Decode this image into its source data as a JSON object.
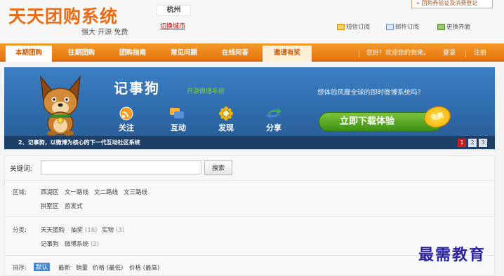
{
  "header": {
    "logo": "天天团购系统",
    "slogan": "强大 开源 免费",
    "city": "杭州",
    "switch_city": "切换城市",
    "verify_link": "» 团购券验证及消费登记",
    "links": [
      {
        "label": "短信订阅",
        "icon": "sms-icon"
      },
      {
        "label": "邮件订阅",
        "icon": "mail-icon"
      },
      {
        "label": "更换界面",
        "icon": "skin-icon"
      }
    ]
  },
  "nav": {
    "tabs": [
      "本期团购",
      "往期团购",
      "团购指南",
      "常见问题",
      "在线问答",
      "邀请有奖"
    ],
    "active_index": 0,
    "greeting": "您好！欢迎您的到来。",
    "login": "登录",
    "register": "注册"
  },
  "banner": {
    "title": "记事狗",
    "subtitle": "开源微博系统",
    "tagline": "想体验风靡全球的即时微博系统吗？",
    "features": [
      "关注",
      "互动",
      "发现",
      "分享"
    ],
    "download_label": "立即下载体验",
    "free_badge": "免费",
    "caption": "2、记事狗，以微博为核心的下一代互动社区系统",
    "pages": [
      "1",
      "2",
      "3"
    ],
    "active_page": 0,
    "colors": {
      "background": "#2f6bab",
      "download": "#4fa11f",
      "badge": "#f4b000"
    }
  },
  "search": {
    "keyword_label": "关键词:",
    "keyword_value": "",
    "button": "搜索"
  },
  "filters": {
    "region_label": "区域:",
    "regions_row1": [
      "西湖区",
      "文一路线",
      "文二路线",
      "文三路线"
    ],
    "regions_row2": [
      "拱墅区",
      "首发式"
    ],
    "category_label": "分类:",
    "categories_row1": [
      {
        "name": "天天团购",
        "count": ""
      },
      {
        "name": "抽奖",
        "count": "(16)"
      },
      {
        "name": "实物",
        "count": "(3)"
      }
    ],
    "categories_row2": [
      {
        "name": "记事狗",
        "count": ""
      },
      {
        "name": "微博系统",
        "count": "(2)"
      }
    ],
    "sort_label": "排序:",
    "sort_options": [
      "默认",
      "最新",
      "销量",
      "价格 (最低)",
      "价格 (最高)"
    ]
  },
  "watermark": "最需教育"
}
